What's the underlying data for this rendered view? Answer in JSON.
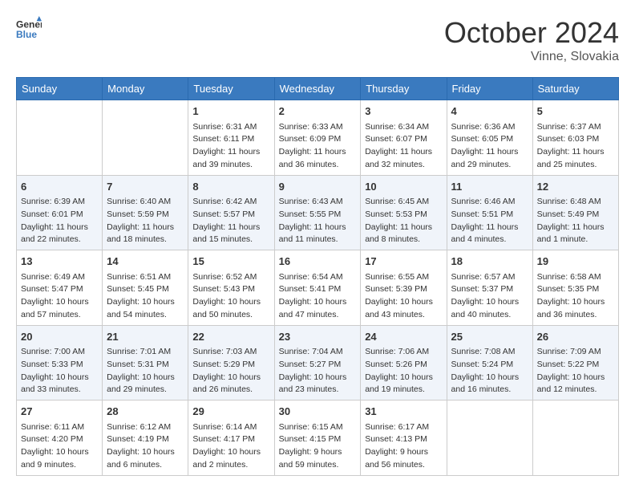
{
  "header": {
    "logo_line1": "General",
    "logo_line2": "Blue",
    "month": "October 2024",
    "location": "Vinne, Slovakia"
  },
  "days_of_week": [
    "Sunday",
    "Monday",
    "Tuesday",
    "Wednesday",
    "Thursday",
    "Friday",
    "Saturday"
  ],
  "weeks": [
    [
      {
        "day": "",
        "sunrise": "",
        "sunset": "",
        "daylight": ""
      },
      {
        "day": "",
        "sunrise": "",
        "sunset": "",
        "daylight": ""
      },
      {
        "day": "1",
        "sunrise": "Sunrise: 6:31 AM",
        "sunset": "Sunset: 6:11 PM",
        "daylight": "Daylight: 11 hours and 39 minutes."
      },
      {
        "day": "2",
        "sunrise": "Sunrise: 6:33 AM",
        "sunset": "Sunset: 6:09 PM",
        "daylight": "Daylight: 11 hours and 36 minutes."
      },
      {
        "day": "3",
        "sunrise": "Sunrise: 6:34 AM",
        "sunset": "Sunset: 6:07 PM",
        "daylight": "Daylight: 11 hours and 32 minutes."
      },
      {
        "day": "4",
        "sunrise": "Sunrise: 6:36 AM",
        "sunset": "Sunset: 6:05 PM",
        "daylight": "Daylight: 11 hours and 29 minutes."
      },
      {
        "day": "5",
        "sunrise": "Sunrise: 6:37 AM",
        "sunset": "Sunset: 6:03 PM",
        "daylight": "Daylight: 11 hours and 25 minutes."
      }
    ],
    [
      {
        "day": "6",
        "sunrise": "Sunrise: 6:39 AM",
        "sunset": "Sunset: 6:01 PM",
        "daylight": "Daylight: 11 hours and 22 minutes."
      },
      {
        "day": "7",
        "sunrise": "Sunrise: 6:40 AM",
        "sunset": "Sunset: 5:59 PM",
        "daylight": "Daylight: 11 hours and 18 minutes."
      },
      {
        "day": "8",
        "sunrise": "Sunrise: 6:42 AM",
        "sunset": "Sunset: 5:57 PM",
        "daylight": "Daylight: 11 hours and 15 minutes."
      },
      {
        "day": "9",
        "sunrise": "Sunrise: 6:43 AM",
        "sunset": "Sunset: 5:55 PM",
        "daylight": "Daylight: 11 hours and 11 minutes."
      },
      {
        "day": "10",
        "sunrise": "Sunrise: 6:45 AM",
        "sunset": "Sunset: 5:53 PM",
        "daylight": "Daylight: 11 hours and 8 minutes."
      },
      {
        "day": "11",
        "sunrise": "Sunrise: 6:46 AM",
        "sunset": "Sunset: 5:51 PM",
        "daylight": "Daylight: 11 hours and 4 minutes."
      },
      {
        "day": "12",
        "sunrise": "Sunrise: 6:48 AM",
        "sunset": "Sunset: 5:49 PM",
        "daylight": "Daylight: 11 hours and 1 minute."
      }
    ],
    [
      {
        "day": "13",
        "sunrise": "Sunrise: 6:49 AM",
        "sunset": "Sunset: 5:47 PM",
        "daylight": "Daylight: 10 hours and 57 minutes."
      },
      {
        "day": "14",
        "sunrise": "Sunrise: 6:51 AM",
        "sunset": "Sunset: 5:45 PM",
        "daylight": "Daylight: 10 hours and 54 minutes."
      },
      {
        "day": "15",
        "sunrise": "Sunrise: 6:52 AM",
        "sunset": "Sunset: 5:43 PM",
        "daylight": "Daylight: 10 hours and 50 minutes."
      },
      {
        "day": "16",
        "sunrise": "Sunrise: 6:54 AM",
        "sunset": "Sunset: 5:41 PM",
        "daylight": "Daylight: 10 hours and 47 minutes."
      },
      {
        "day": "17",
        "sunrise": "Sunrise: 6:55 AM",
        "sunset": "Sunset: 5:39 PM",
        "daylight": "Daylight: 10 hours and 43 minutes."
      },
      {
        "day": "18",
        "sunrise": "Sunrise: 6:57 AM",
        "sunset": "Sunset: 5:37 PM",
        "daylight": "Daylight: 10 hours and 40 minutes."
      },
      {
        "day": "19",
        "sunrise": "Sunrise: 6:58 AM",
        "sunset": "Sunset: 5:35 PM",
        "daylight": "Daylight: 10 hours and 36 minutes."
      }
    ],
    [
      {
        "day": "20",
        "sunrise": "Sunrise: 7:00 AM",
        "sunset": "Sunset: 5:33 PM",
        "daylight": "Daylight: 10 hours and 33 minutes."
      },
      {
        "day": "21",
        "sunrise": "Sunrise: 7:01 AM",
        "sunset": "Sunset: 5:31 PM",
        "daylight": "Daylight: 10 hours and 29 minutes."
      },
      {
        "day": "22",
        "sunrise": "Sunrise: 7:03 AM",
        "sunset": "Sunset: 5:29 PM",
        "daylight": "Daylight: 10 hours and 26 minutes."
      },
      {
        "day": "23",
        "sunrise": "Sunrise: 7:04 AM",
        "sunset": "Sunset: 5:27 PM",
        "daylight": "Daylight: 10 hours and 23 minutes."
      },
      {
        "day": "24",
        "sunrise": "Sunrise: 7:06 AM",
        "sunset": "Sunset: 5:26 PM",
        "daylight": "Daylight: 10 hours and 19 minutes."
      },
      {
        "day": "25",
        "sunrise": "Sunrise: 7:08 AM",
        "sunset": "Sunset: 5:24 PM",
        "daylight": "Daylight: 10 hours and 16 minutes."
      },
      {
        "day": "26",
        "sunrise": "Sunrise: 7:09 AM",
        "sunset": "Sunset: 5:22 PM",
        "daylight": "Daylight: 10 hours and 12 minutes."
      }
    ],
    [
      {
        "day": "27",
        "sunrise": "Sunrise: 6:11 AM",
        "sunset": "Sunset: 4:20 PM",
        "daylight": "Daylight: 10 hours and 9 minutes."
      },
      {
        "day": "28",
        "sunrise": "Sunrise: 6:12 AM",
        "sunset": "Sunset: 4:19 PM",
        "daylight": "Daylight: 10 hours and 6 minutes."
      },
      {
        "day": "29",
        "sunrise": "Sunrise: 6:14 AM",
        "sunset": "Sunset: 4:17 PM",
        "daylight": "Daylight: 10 hours and 2 minutes."
      },
      {
        "day": "30",
        "sunrise": "Sunrise: 6:15 AM",
        "sunset": "Sunset: 4:15 PM",
        "daylight": "Daylight: 9 hours and 59 minutes."
      },
      {
        "day": "31",
        "sunrise": "Sunrise: 6:17 AM",
        "sunset": "Sunset: 4:13 PM",
        "daylight": "Daylight: 9 hours and 56 minutes."
      },
      {
        "day": "",
        "sunrise": "",
        "sunset": "",
        "daylight": ""
      },
      {
        "day": "",
        "sunrise": "",
        "sunset": "",
        "daylight": ""
      }
    ]
  ]
}
